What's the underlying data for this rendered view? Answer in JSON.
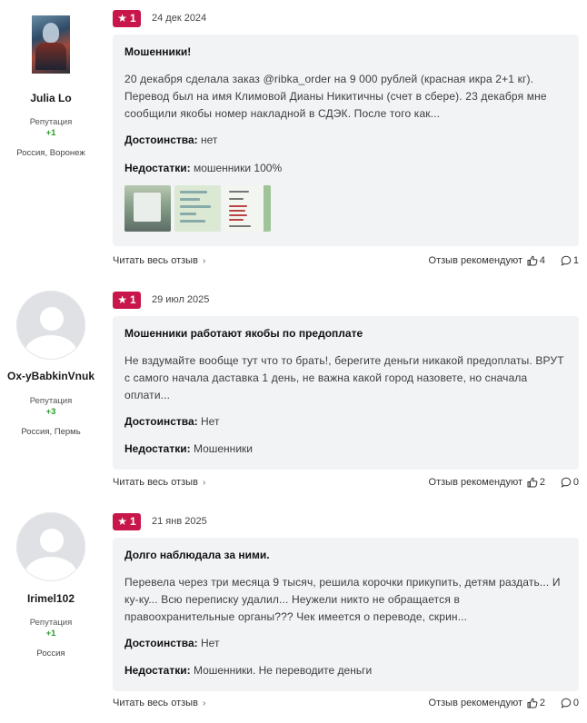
{
  "common": {
    "reputation_label": "Репутация",
    "advantages_label": "Достоинства:",
    "disadvantages_label": "Недостатки:",
    "read_more_label": "Читать весь отзыв",
    "recommend_label": "Отзыв рекомендуют",
    "accent_color": "#c8164a",
    "reputation_color": "#2a9a2a"
  },
  "reviews": [
    {
      "author": {
        "name": "Julia Lo",
        "reputation": "+1",
        "location": "Россия, Воронеж",
        "avatar": "photo"
      },
      "rating": "1",
      "date": "24 дек 2024",
      "title": "Мошенники!",
      "text": "20 декабря сделала заказ @ribka_order на 9 000 рублей (красная икра 2+1 кг). Перевод был на имя Климовой Дианы Никитичны (счет в сбере). 23 декабря мне сообщили якобы номер накладной в СДЭК. После того как...",
      "advantages": "нет",
      "disadvantages": "мошенники 100%",
      "likes": "4",
      "comments": "1"
    },
    {
      "author": {
        "name": "Ox-yBabkinVnuk",
        "reputation": "+3",
        "location": "Россия, Пермь",
        "avatar": "default"
      },
      "rating": "1",
      "date": "29 июл 2025",
      "title": "Мошенники работают якобы по предоплате",
      "text": "Не вздумайте вообще тут что то брать!, берегите деньги никакой предоплаты. ВРУТ с самого начала даставка 1 день, не важна какой город назовете, но сначала оплати...",
      "advantages": "Нет",
      "disadvantages": "Мошенники",
      "likes": "2",
      "comments": "0"
    },
    {
      "author": {
        "name": "Irimel102",
        "reputation": "+1",
        "location": "Россия",
        "avatar": "default"
      },
      "rating": "1",
      "date": "21 янв 2025",
      "title": "Долго наблюдала за ними.",
      "text": "Перевела через три месяца 9 тысяч, решила корочки прикупить, детям раздать... И ку-ку... Всю переписку удалил... Неужели никто не обращается в правоохранительные органы??? Чек имеется о переводе, скрин...",
      "advantages": "Нет",
      "disadvantages": "Мошенники. Не переводите деньги",
      "likes": "2",
      "comments": "0"
    }
  ]
}
